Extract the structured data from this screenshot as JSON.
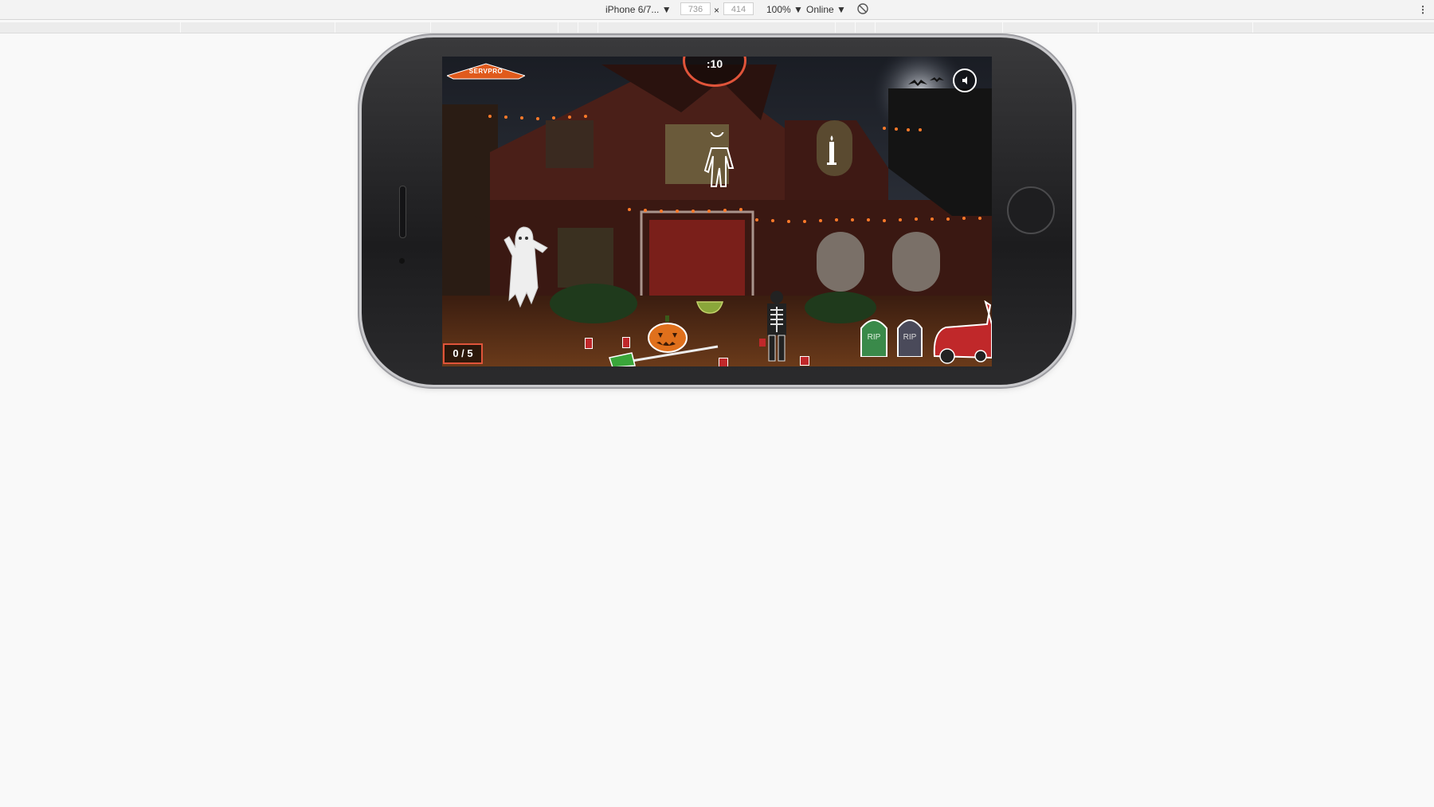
{
  "devtools": {
    "device": "iPhone 6/7...",
    "width_value": "736",
    "height_value": "414",
    "times": "×",
    "zoom": "100%",
    "network": "Online",
    "more": "⋮"
  },
  "game": {
    "logo": "SERVPRO",
    "timer": ":10",
    "score": "0 / 5",
    "tombstone_left": "RIP",
    "tombstone_right": "RIP"
  },
  "colors": {
    "accent": "#e0543a",
    "sky": "#2a2f3a",
    "house_brick": "#4a1f18",
    "lights": "#ff7a2a"
  }
}
